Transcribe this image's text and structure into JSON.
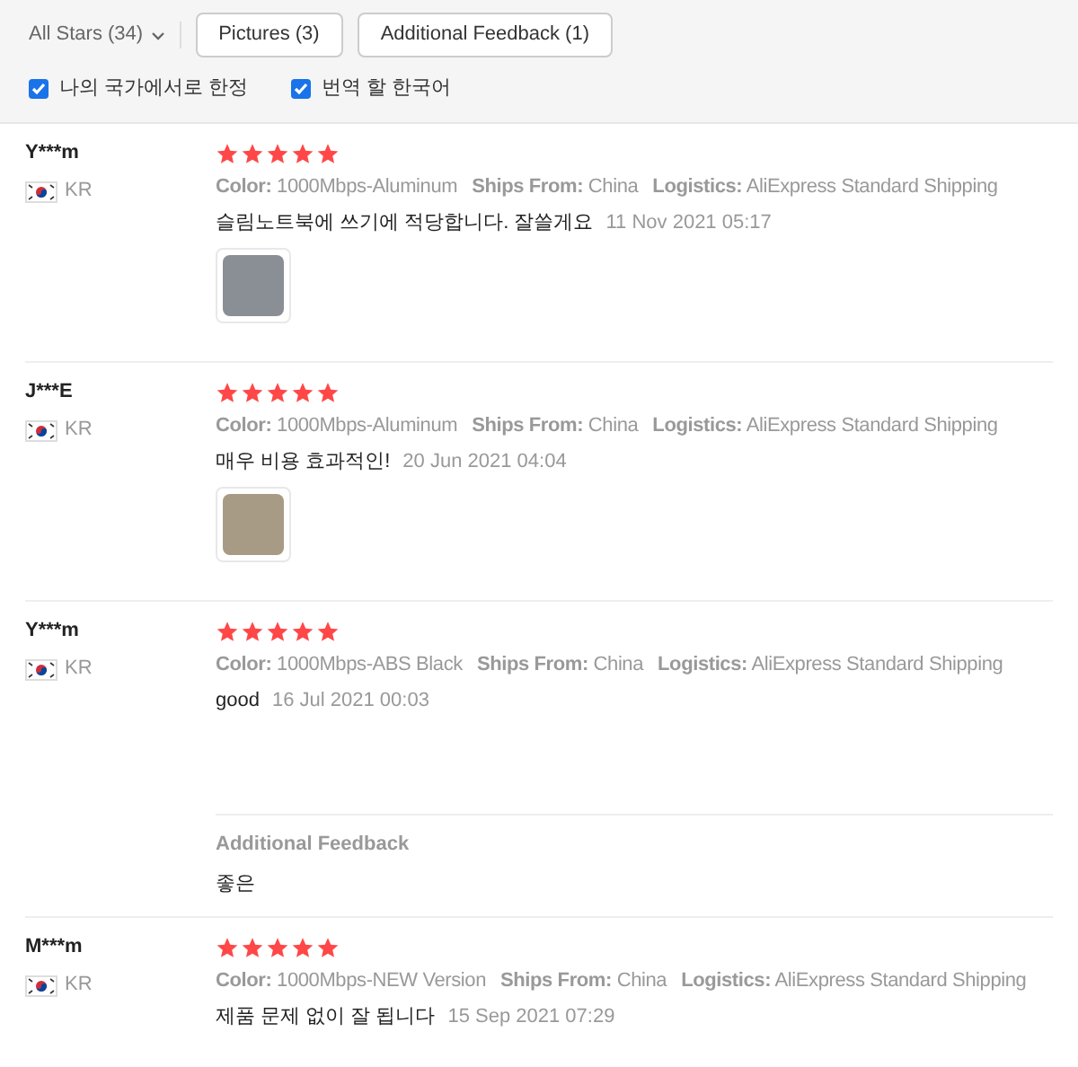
{
  "filters": {
    "star_filter": "All Stars (34)",
    "buttons": [
      {
        "label": "Pictures (3)",
        "selected": false
      },
      {
        "label": "Additional Feedback (1)",
        "selected": false
      }
    ],
    "checkboxes": [
      {
        "label": "나의 국가에서로 한정",
        "checked": true
      },
      {
        "label": "번역 할 한국어",
        "checked": true
      }
    ]
  },
  "reviews": [
    {
      "user": "Y***m",
      "country": "KR",
      "stars": 5,
      "attributes": [
        {
          "label": "Color:",
          "value": "1000Mbps-Aluminum"
        },
        {
          "label": "Ships From:",
          "value": "China"
        },
        {
          "label": "Logistics:",
          "value": "AliExpress Standard Shipping"
        }
      ],
      "text": "슬림노트북에 쓰기에 적당합니다. 잘쓸게요",
      "date": "11 Nov 2021 05:17",
      "has_photo": true
    },
    {
      "user": "J***E",
      "country": "KR",
      "stars": 5,
      "attributes": [
        {
          "label": "Color:",
          "value": "1000Mbps-Aluminum"
        },
        {
          "label": "Ships From:",
          "value": "China"
        },
        {
          "label": "Logistics:",
          "value": "AliExpress Standard Shipping"
        }
      ],
      "text": "매우 비용 효과적인!",
      "date": "20 Jun 2021 04:04",
      "has_photo": true
    },
    {
      "user": "Y***m",
      "country": "KR",
      "stars": 5,
      "attributes": [
        {
          "label": "Color:",
          "value": "1000Mbps-ABS Black"
        },
        {
          "label": "Ships From:",
          "value": "China"
        },
        {
          "label": "Logistics:",
          "value": "AliExpress Standard Shipping"
        }
      ],
      "text": "good",
      "date": "16 Jul 2021 00:03",
      "has_photo": false,
      "additional_feedback": {
        "title": "Additional Feedback",
        "text": "좋은"
      }
    },
    {
      "user": "M***m",
      "country": "KR",
      "stars": 5,
      "attributes": [
        {
          "label": "Color:",
          "value": "1000Mbps-NEW Version"
        },
        {
          "label": "Ships From:",
          "value": "China"
        },
        {
          "label": "Logistics:",
          "value": "AliExpress Standard Shipping"
        }
      ],
      "text": "제품 문제 없이 잘 됩니다",
      "date": "15 Sep 2021 07:29",
      "has_photo": false
    }
  ]
}
